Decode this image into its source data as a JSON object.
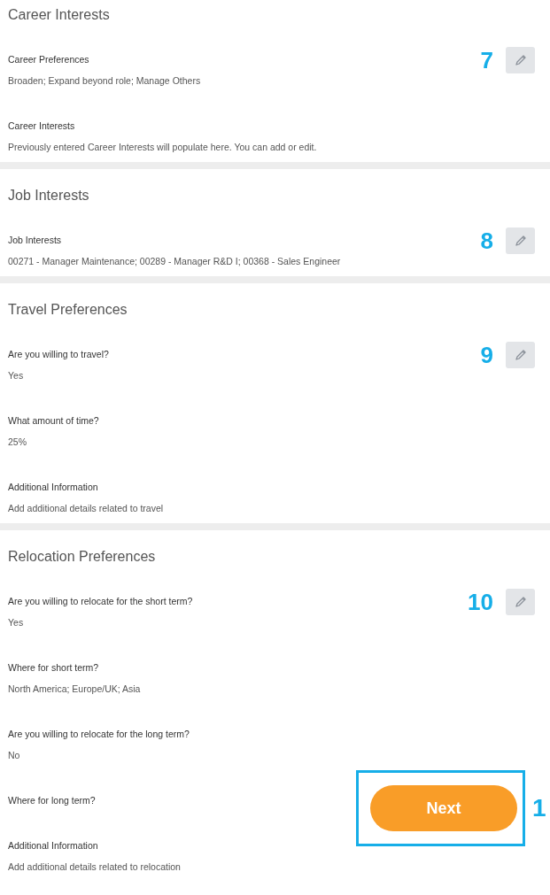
{
  "sections": [
    {
      "title": "Career Interests",
      "step": "7",
      "fields": [
        {
          "label": "Career Preferences",
          "value": "Broaden; Expand beyond role; Manage Others"
        },
        {
          "label": "Career Interests",
          "value": "Previously entered Career Interests will populate here. You can add or edit."
        }
      ]
    },
    {
      "title": "Job Interests",
      "step": "8",
      "fields": [
        {
          "label": "Job Interests",
          "value": "00271 - Manager Maintenance; 00289 - Manager R&D I; 00368 - Sales Engineer"
        }
      ]
    },
    {
      "title": "Travel Preferences",
      "step": "9",
      "fields": [
        {
          "label": "Are you willing to travel?",
          "value": "Yes"
        },
        {
          "label": "What amount of time?",
          "value": "25%"
        },
        {
          "label": "Additional Information",
          "value": "Add additional details related to travel"
        }
      ]
    },
    {
      "title": "Relocation Preferences",
      "step": "10",
      "fields": [
        {
          "label": "Are you willing to relocate for the short term?",
          "value": "Yes"
        },
        {
          "label": "Where for short term?",
          "value": "North America; Europe/UK; Asia"
        },
        {
          "label": "Are you willing to relocate for the long term?",
          "value": "No"
        },
        {
          "label": "Where for long term?"
        },
        {
          "label": "Additional Information",
          "value": "Add additional details related to relocation"
        }
      ]
    }
  ],
  "next_button": {
    "label": "Next",
    "step": "1"
  }
}
